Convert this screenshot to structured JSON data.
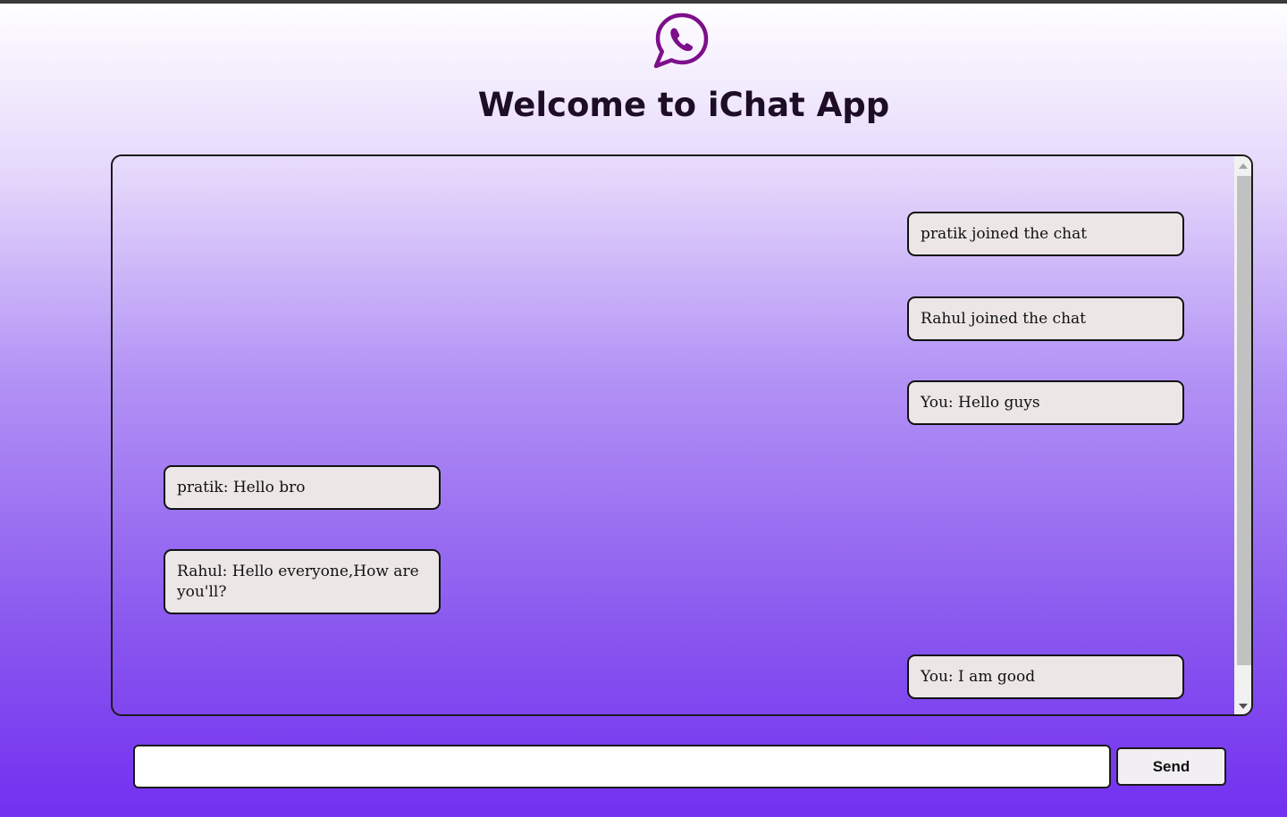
{
  "header": {
    "logo_icon": "whatsapp-icon",
    "logo_color": "#7d0f8a",
    "title": "Welcome to iChat App"
  },
  "chat": {
    "messages": [
      {
        "text": "pratik joined the chat",
        "position": "right"
      },
      {
        "text": "Rahul joined the chat",
        "position": "right"
      },
      {
        "text": "You: Hello guys",
        "position": "right"
      },
      {
        "text": "pratik: Hello bro",
        "position": "left"
      },
      {
        "text": "Rahul: Hello everyone,How are you'll?",
        "position": "left"
      },
      {
        "text": "You: I am good",
        "position": "right"
      }
    ]
  },
  "composer": {
    "input_value": "",
    "send_label": "Send"
  }
}
